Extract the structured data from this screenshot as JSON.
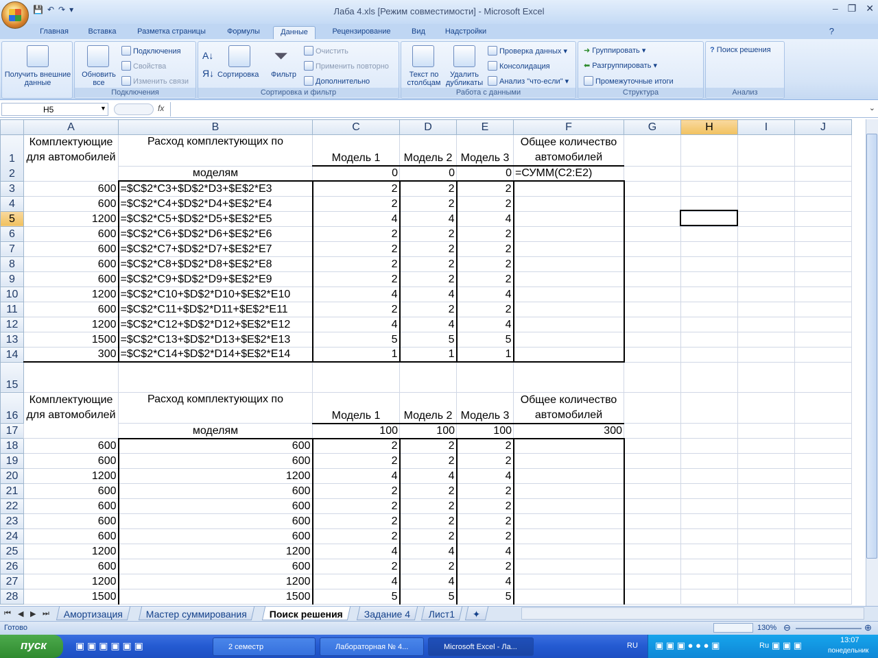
{
  "window": {
    "title": "Лаба 4.xls  [Режим совместимости] - Microsoft Excel",
    "controls": [
      "‒",
      "❐",
      "✕"
    ]
  },
  "ribbon_tabs": [
    "Главная",
    "Вставка",
    "Разметка страницы",
    "Формулы",
    "Данные",
    "Рецензирование",
    "Вид",
    "Надстройки"
  ],
  "active_tab": "Данные",
  "ribbon": {
    "get_external": "Получить внешние данные",
    "refresh_all": "Обновить все",
    "connections": "Подключения",
    "properties": "Свойства",
    "edit_links": "Изменить связи",
    "group_connections": "Подключения",
    "sort": "Сортировка",
    "filter": "Фильтр",
    "clear": "Очистить",
    "reapply": "Применить повторно",
    "advanced": "Дополнительно",
    "group_sort": "Сортировка и фильтр",
    "text_to_columns": "Текст по столбцам",
    "remove_duplicates": "Удалить дубликаты",
    "data_validation": "Проверка данных",
    "consolidate": "Консолидация",
    "what_if": "Анализ \"что-если\"",
    "group_data": "Работа с данными",
    "group": "Группировать",
    "ungroup": "Разгруппировать",
    "subtotal": "Промежуточные итоги",
    "group_structure": "Структура",
    "solver": "Поиск решения",
    "group_analysis": "Анализ"
  },
  "formula_bar": {
    "name_box": "H5",
    "fx": "fx",
    "value": ""
  },
  "columns": [
    "A",
    "B",
    "C",
    "D",
    "E",
    "F",
    "G",
    "H",
    "I",
    "J"
  ],
  "selected_column": "H",
  "selected_row": "5",
  "header1": {
    "a": "Комплектующие для автомобилей",
    "b_top": "Расход комплектующих по",
    "b_bottom": "моделям",
    "c": "Модель 1",
    "d": "Модель 2",
    "e": "Модель 3",
    "f": "Общее количество автомобилей"
  },
  "row2": {
    "c": "0",
    "d": "0",
    "e": "0",
    "f": "=СУММ(C2:E2)"
  },
  "block1": [
    {
      "row": "3",
      "a": "600",
      "b": "=$C$2*C3+$D$2*D3+$E$2*E3",
      "c": "2",
      "d": "2",
      "e": "2"
    },
    {
      "row": "4",
      "a": "600",
      "b": "=$C$2*C4+$D$2*D4+$E$2*E4",
      "c": "2",
      "d": "2",
      "e": "2"
    },
    {
      "row": "5",
      "a": "1200",
      "b": "=$C$2*C5+$D$2*D5+$E$2*E5",
      "c": "4",
      "d": "4",
      "e": "4"
    },
    {
      "row": "6",
      "a": "600",
      "b": "=$C$2*C6+$D$2*D6+$E$2*E6",
      "c": "2",
      "d": "2",
      "e": "2"
    },
    {
      "row": "7",
      "a": "600",
      "b": "=$C$2*C7+$D$2*D7+$E$2*E7",
      "c": "2",
      "d": "2",
      "e": "2"
    },
    {
      "row": "8",
      "a": "600",
      "b": "=$C$2*C8+$D$2*D8+$E$2*E8",
      "c": "2",
      "d": "2",
      "e": "2"
    },
    {
      "row": "9",
      "a": "600",
      "b": "=$C$2*C9+$D$2*D9+$E$2*E9",
      "c": "2",
      "d": "2",
      "e": "2"
    },
    {
      "row": "10",
      "a": "1200",
      "b": "=$C$2*C10+$D$2*D10+$E$2*E10",
      "c": "4",
      "d": "4",
      "e": "4"
    },
    {
      "row": "11",
      "a": "600",
      "b": "=$C$2*C11+$D$2*D11+$E$2*E11",
      "c": "2",
      "d": "2",
      "e": "2"
    },
    {
      "row": "12",
      "a": "1200",
      "b": "=$C$2*C12+$D$2*D12+$E$2*E12",
      "c": "4",
      "d": "4",
      "e": "4"
    },
    {
      "row": "13",
      "a": "1500",
      "b": "=$C$2*C13+$D$2*D13+$E$2*E13",
      "c": "5",
      "d": "5",
      "e": "5"
    },
    {
      "row": "14",
      "a": "300",
      "b": "=$C$2*C14+$D$2*D14+$E$2*E14",
      "c": "1",
      "d": "1",
      "e": "1"
    }
  ],
  "row17": {
    "c": "100",
    "d": "100",
    "e": "100",
    "f": "300"
  },
  "block2": [
    {
      "row": "18",
      "a": "600",
      "b": "600",
      "c": "2",
      "d": "2",
      "e": "2"
    },
    {
      "row": "19",
      "a": "600",
      "b": "600",
      "c": "2",
      "d": "2",
      "e": "2"
    },
    {
      "row": "20",
      "a": "1200",
      "b": "1200",
      "c": "4",
      "d": "4",
      "e": "4"
    },
    {
      "row": "21",
      "a": "600",
      "b": "600",
      "c": "2",
      "d": "2",
      "e": "2"
    },
    {
      "row": "22",
      "a": "600",
      "b": "600",
      "c": "2",
      "d": "2",
      "e": "2"
    },
    {
      "row": "23",
      "a": "600",
      "b": "600",
      "c": "2",
      "d": "2",
      "e": "2"
    },
    {
      "row": "24",
      "a": "600",
      "b": "600",
      "c": "2",
      "d": "2",
      "e": "2"
    },
    {
      "row": "25",
      "a": "1200",
      "b": "1200",
      "c": "4",
      "d": "4",
      "e": "4"
    },
    {
      "row": "26",
      "a": "600",
      "b": "600",
      "c": "2",
      "d": "2",
      "e": "2"
    },
    {
      "row": "27",
      "a": "1200",
      "b": "1200",
      "c": "4",
      "d": "4",
      "e": "4"
    },
    {
      "row": "28",
      "a": "1500",
      "b": "1500",
      "c": "5",
      "d": "5",
      "e": "5"
    }
  ],
  "sheet_tabs": [
    "Амортизация",
    "Мастер суммирования",
    "Поиск решения",
    "Задание 4",
    "Лист1"
  ],
  "active_sheet": "Поиск решения",
  "status": {
    "ready": "Готово",
    "zoom": "130%"
  },
  "taskbar": {
    "start": "пуск",
    "buttons": [
      "2 семестр",
      "Лабораторная № 4...",
      "Microsoft Excel - Ла..."
    ],
    "lang": "RU",
    "tray_lang": "Ru",
    "time": "13:07",
    "day": "понедельник"
  }
}
